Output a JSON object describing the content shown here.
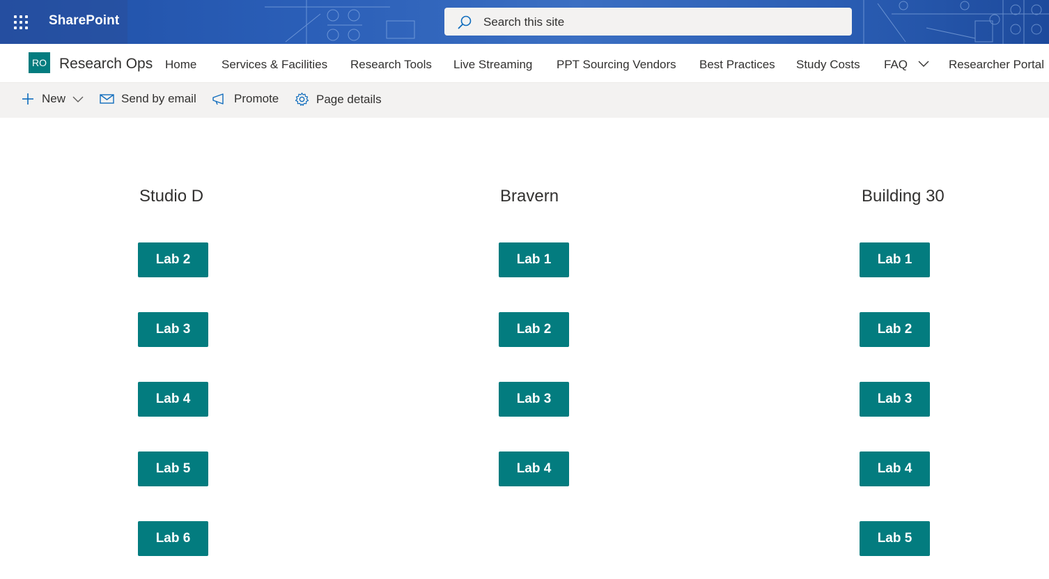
{
  "suitebar": {
    "app_name": "SharePoint",
    "search_placeholder": "Search this site",
    "bg_color": "#2b5fb8"
  },
  "site": {
    "logo_initials": "RO",
    "logo_color": "#037c7f",
    "title": "Research Ops"
  },
  "nav": {
    "items": [
      {
        "label": "Home"
      },
      {
        "label": "Services & Facilities"
      },
      {
        "label": "Research Tools"
      },
      {
        "label": "Live Streaming"
      },
      {
        "label": "PPT Sourcing Vendors"
      },
      {
        "label": "Best Practices"
      },
      {
        "label": "Study Costs"
      },
      {
        "label": "FAQ",
        "has_dropdown": true
      },
      {
        "label": "Researcher Portal"
      }
    ]
  },
  "commandbar": {
    "new_label": "New",
    "email_label": "Send by email",
    "promote_label": "Promote",
    "details_label": "Page details"
  },
  "columns": [
    {
      "heading": "Studio D",
      "labs": [
        "Lab 2",
        "Lab 3",
        "Lab 4",
        "Lab 5",
        "Lab 6"
      ]
    },
    {
      "heading": "Bravern",
      "labs": [
        "Lab 1",
        "Lab 2",
        "Lab 3",
        "Lab 4"
      ]
    },
    {
      "heading": "Building 30",
      "labs": [
        "Lab 1",
        "Lab 2",
        "Lab 3",
        "Lab 4",
        "Lab 5"
      ]
    }
  ],
  "colors": {
    "button": "#037c7f",
    "command_bar_bg": "#f3f2f1"
  }
}
